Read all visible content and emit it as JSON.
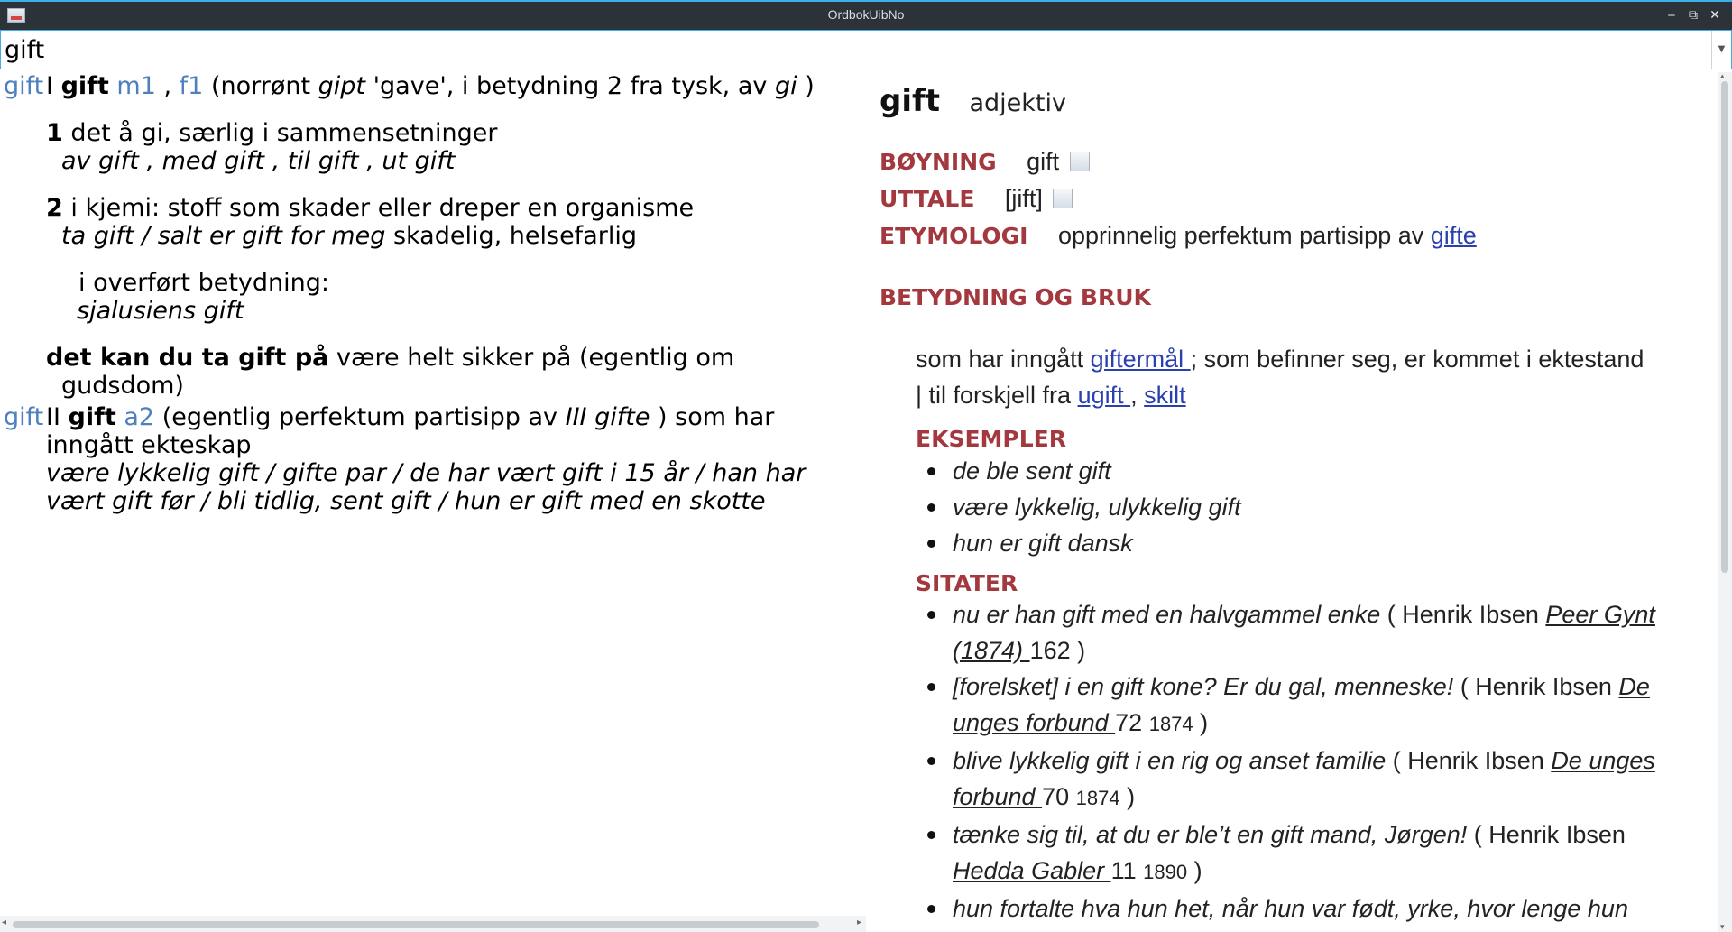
{
  "window": {
    "title": "OrdbokUibNo",
    "buttons": {
      "minimize": "‒",
      "maximize": "⧉",
      "close": "✕"
    }
  },
  "search": {
    "value": "gift",
    "dropdown_icon": "chevron-down-icon"
  },
  "left": {
    "entry1": {
      "label": "gift",
      "homograph": "I",
      "headword": "gift",
      "gender1": "m1",
      "sep1": ",",
      "gender2": "f1",
      "etym_pre": "(norrønt",
      "etym_word": "gipt",
      "etym_mid": "'gave', i betydning 2 fra tysk, av",
      "etym_word2": "gi",
      "etym_close": ")",
      "sense1_num": "1",
      "sense1_text": "det å gi, særlig i sammensetninger",
      "sense1_ex": "av gift , med gift , til gift , ut gift",
      "sense2_num": "2",
      "sense2_text": "i kjemi: stoff som skader eller dreper en organisme",
      "sense2_ex": "ta gift / salt er gift for meg",
      "sense2_ex_rest": "skadelig, helsefarlig",
      "sub_label": "i overført betydning:",
      "sub_ex": "sjalusiens gift",
      "idiom_bold": "det kan du ta gift på",
      "idiom_text": "være helt sikker på (egentlig om",
      "idiom_cont": "gudsdom)"
    },
    "entry2": {
      "label": "gift",
      "homograph": "II",
      "headword": "gift",
      "class": "a2",
      "etym_pre": "(egentlig perfektum partisipp av",
      "etym_word": "III gifte",
      "etym_post": ") som har",
      "line2": "inngått ekteskap",
      "ex1": "være lykkelig gift / gifte par / de har vært gift i 15 år / han har",
      "ex2": "vært gift før / bli tidlig, sent gift / hun er gift med en skotte"
    }
  },
  "right": {
    "headword": "gift",
    "pos": "adjektiv",
    "boyning_label": "BØYNING",
    "boyning_value": "gift",
    "uttale_label": "UTTALE",
    "uttale_value": "[jift]",
    "etymologi_label": "ETYMOLOGI",
    "etymologi_text": "opprinnelig perfektum partisipp av",
    "etymologi_link": "gifte",
    "betydning_label": "BETYDNING OG BRUK",
    "meaning_pre": "som har inngått",
    "meaning_link1": "giftermål ",
    "meaning_mid": "; som befinner seg, er kommet i ektestand",
    "meaning_line2_pre": "| til forskjell fra",
    "meaning_link2": "ugift ",
    "meaning_comma": ",",
    "meaning_link3": "skilt",
    "eksempler_label": "EKSEMPLER",
    "examples": [
      "de ble sent gift",
      "være lykkelig, ulykkelig gift",
      "hun er gift dansk"
    ],
    "sitater_label": "SITATER",
    "quotes": [
      {
        "text": "nu er han gift med en halvgammel enke",
        "open": " ( Henrik Ibsen ",
        "work": "Peer Gynt (1874) ",
        "page": "162",
        "year": "",
        "close": " )"
      },
      {
        "text": "[forelsket] i en gift kone? Er du gal, menneske!",
        "open": " ( Henrik Ibsen ",
        "work": "De unges forbund ",
        "page": "72",
        "year": "1874",
        "close": " )"
      },
      {
        "text": "blive lykkelig gift i en rig og anset familie",
        "open": " ( Henrik Ibsen ",
        "work": "De unges forbund ",
        "page": "70",
        "year": "1874",
        "close": " )"
      },
      {
        "text": "tænke sig til, at du er ble’t en gift mand, Jørgen!",
        "open": " ( Henrik Ibsen ",
        "work": "Hedda Gabler ",
        "page": "11",
        "year": "1890",
        "close": " )"
      },
      {
        "text": "hun fortalte hva hun het, når hun var født, yrke, hvor lenge hun",
        "open": "",
        "work": "",
        "page": "",
        "year": "",
        "close": ""
      }
    ]
  }
}
